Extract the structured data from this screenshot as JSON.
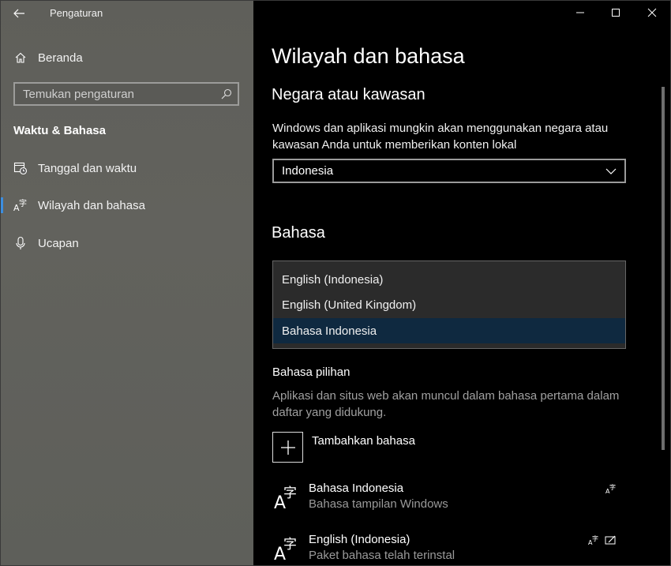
{
  "window": {
    "app_title": "Pengaturan",
    "controls": {
      "minimize": "minimize-icon",
      "maximize": "maximize-icon",
      "close": "close-icon"
    }
  },
  "sidebar": {
    "home_label": "Beranda",
    "search_placeholder": "Temukan pengaturan",
    "section_title": "Waktu & Bahasa",
    "items": [
      {
        "label": "Tanggal dan waktu",
        "icon": "calendar-clock-icon"
      },
      {
        "label": "Wilayah dan bahasa",
        "icon": "language-icon",
        "active": true
      },
      {
        "label": "Ucapan",
        "icon": "microphone-icon"
      }
    ],
    "accent": "#3c8ee0"
  },
  "main": {
    "page_title": "Wilayah dan bahasa",
    "country": {
      "heading": "Negara atau kawasan",
      "description": "Windows dan aplikasi mungkin akan menggunakan negara atau kawasan Anda untuk memberikan konten lokal",
      "selected": "Indonesia"
    },
    "language": {
      "heading": "Bahasa",
      "dropdown_options": [
        "English (Indonesia)",
        "English (United Kingdom)",
        "Bahasa Indonesia"
      ],
      "highlighted_option": "Bahasa Indonesia"
    },
    "preferred": {
      "heading": "Bahasa pilihan",
      "description": "Aplikasi dan situs web akan muncul dalam bahasa pertama dalam daftar yang didukung.",
      "add_label": "Tambahkan bahasa",
      "languages": [
        {
          "name": "Bahasa Indonesia",
          "desc": "Bahasa tampilan Windows"
        },
        {
          "name": "English (Indonesia)",
          "desc": "Paket bahasa telah terinstal"
        }
      ]
    }
  }
}
